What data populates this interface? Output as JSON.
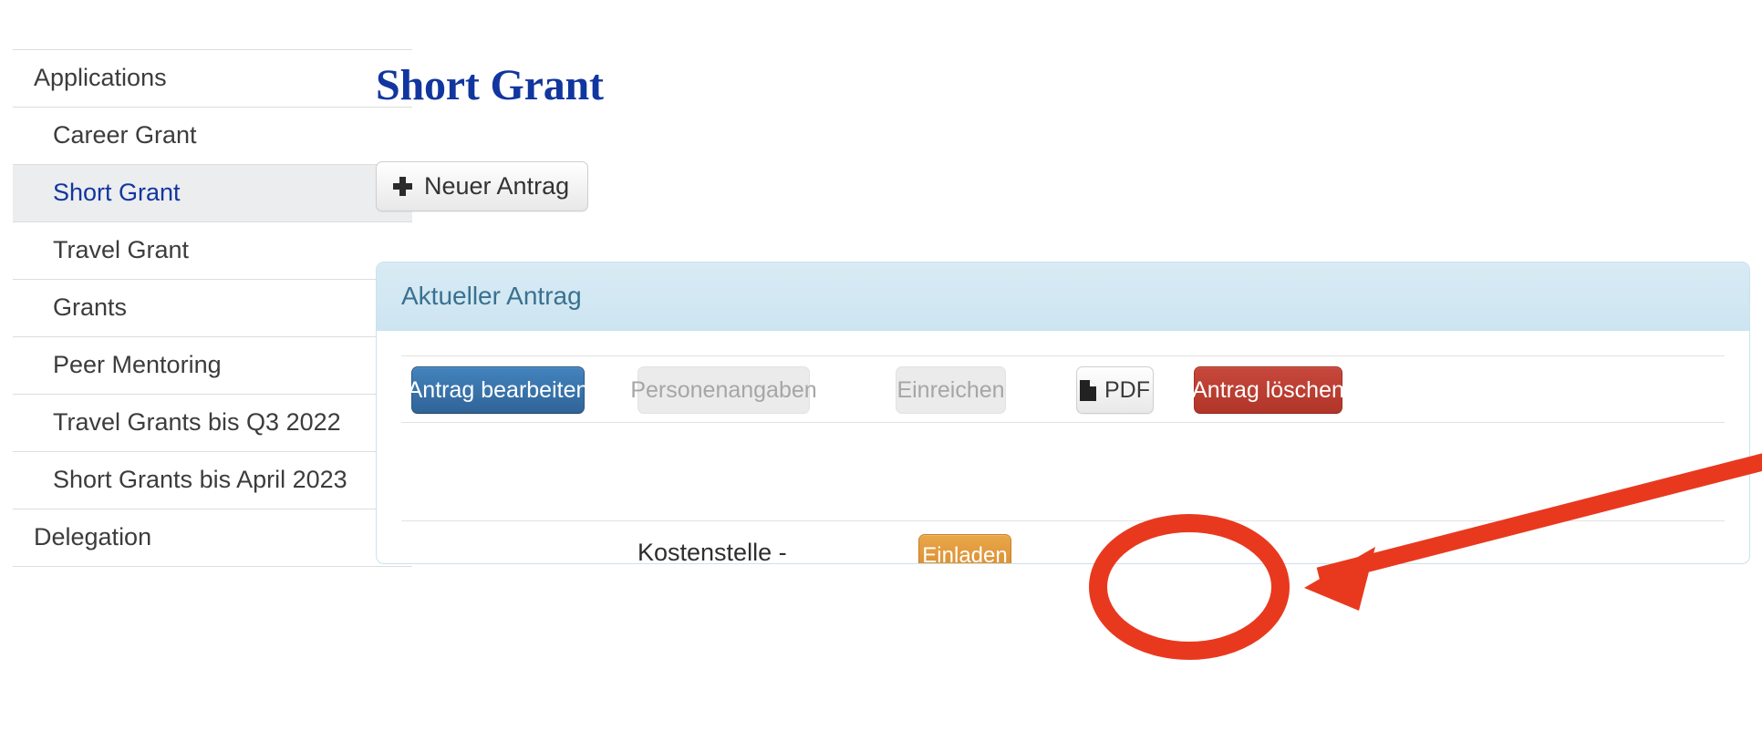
{
  "sidebar": {
    "items": [
      {
        "label": "Applications",
        "level": 0,
        "active": false
      },
      {
        "label": "Career Grant",
        "level": 1,
        "active": false
      },
      {
        "label": "Short Grant",
        "level": 1,
        "active": true
      },
      {
        "label": "Travel Grant",
        "level": 1,
        "active": false
      },
      {
        "label": "Grants",
        "level": 1,
        "active": false
      },
      {
        "label": "Peer Mentoring",
        "level": 1,
        "active": false
      },
      {
        "label": "Travel Grants bis Q3 2022",
        "level": 1,
        "active": false
      },
      {
        "label": "Short Grants bis April 2023",
        "level": 1,
        "active": false
      },
      {
        "label": "Delegation",
        "level": 0,
        "active": false
      }
    ]
  },
  "main": {
    "page_title": "Short Grant",
    "new_application_button": "Neuer Antrag",
    "new_application_icon": "plus-icon"
  },
  "panel": {
    "header_title": "Aktueller Antrag",
    "actions": [
      {
        "label": "Antrag bearbeiten",
        "style": "primary",
        "enabled": true
      },
      {
        "label": "Personenangaben",
        "style": "muted",
        "enabled": false
      },
      {
        "label": "Einreichen",
        "style": "muted",
        "enabled": false
      },
      {
        "label": "PDF",
        "style": "default",
        "enabled": true,
        "icon": "file-pdf-icon"
      },
      {
        "label": "Antrag löschen",
        "style": "danger",
        "enabled": true
      }
    ],
    "cost_center_label": "Kostenstelle -",
    "invite_button": "Einladen"
  },
  "annotation": {
    "type": "highlight-circle-and-arrow",
    "color": "#e8391f",
    "target": "Einladen"
  },
  "colors": {
    "page_title": "#12369f",
    "sidebar_active_text": "#12369f",
    "sidebar_active_bg": "#ecedef",
    "panel_border": "#c9e2ee",
    "panel_header_bg": "#cde5f1",
    "panel_header_text": "#3a718f",
    "primary_button": "#3a76ae",
    "danger_button": "#bb3c2e",
    "warning_button": "#de9338",
    "annotation_red": "#e8391f"
  }
}
